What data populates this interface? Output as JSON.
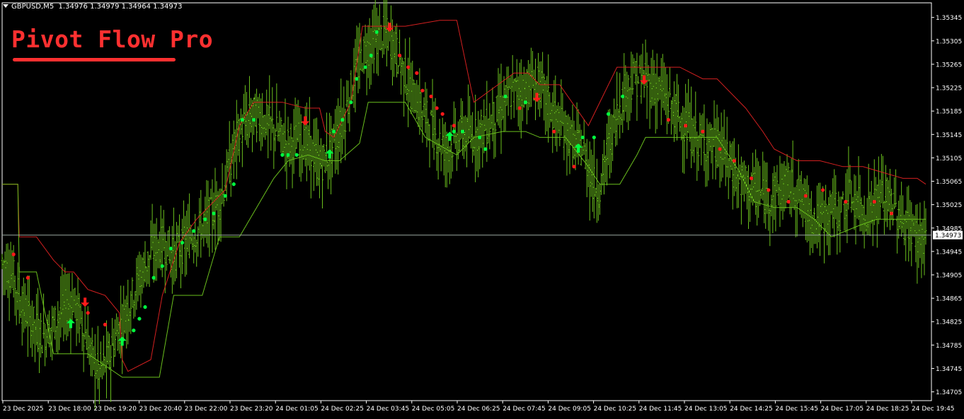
{
  "header": {
    "symbol": "GBPUSD,M5",
    "ohlc": "1.34976 1.34979 1.34964 1.34973"
  },
  "brand": {
    "title": "Pivot Flow Pro"
  },
  "colors": {
    "background": "#000000",
    "axis": "#ffffff",
    "bars": "#6abf1d",
    "bull_signal": "#00ff40",
    "bear_signal": "#ff1a1a",
    "upper_line": "#d32020",
    "lower_line": "#6abf1d",
    "bid_line": "#9aa8a0"
  },
  "chart_data": {
    "type": "bar",
    "title": "",
    "xlabel": "",
    "ylabel": "",
    "ylim": [
      1.3469,
      1.3537
    ],
    "grid": false,
    "y_ticks": [
      "1.35345",
      "1.35305",
      "1.35265",
      "1.35225",
      "1.35185",
      "1.35145",
      "1.35105",
      "1.35065",
      "1.35025",
      "1.34985",
      "1.34945",
      "1.34905",
      "1.34865",
      "1.34825",
      "1.34785",
      "1.34745",
      "1.34705"
    ],
    "current_price": "1.34973",
    "x_ticks": [
      "23 Dec 2025",
      "23 Dec 18:00",
      "23 Dec 19:20",
      "23 Dec 20:40",
      "23 Dec 22:00",
      "23 Dec 23:20",
      "24 Dec 01:05",
      "24 Dec 02:25",
      "24 Dec 03:45",
      "24 Dec 05:05",
      "24 Dec 06:25",
      "24 Dec 07:45",
      "24 Dec 09:05",
      "24 Dec 10:25",
      "24 Dec 11:45",
      "24 Dec 13:05",
      "24 Dec 14:25",
      "24 Dec 15:45",
      "24 Dec 17:05",
      "24 Dec 18:25",
      "24 Dec 19:45"
    ],
    "price_path": [
      [
        0,
        1.3493
      ],
      [
        8,
        1.349
      ],
      [
        14,
        1.3485
      ],
      [
        20,
        1.3483
      ],
      [
        28,
        1.348
      ],
      [
        36,
        1.3482
      ],
      [
        44,
        1.3485
      ],
      [
        50,
        1.3486
      ],
      [
        56,
        1.3482
      ],
      [
        62,
        1.3477
      ],
      [
        68,
        1.3474
      ],
      [
        74,
        1.3476
      ],
      [
        80,
        1.348
      ],
      [
        88,
        1.3485
      ],
      [
        96,
        1.349
      ],
      [
        104,
        1.3494
      ],
      [
        112,
        1.3496
      ],
      [
        120,
        1.3494
      ],
      [
        128,
        1.3496
      ],
      [
        136,
        1.3498
      ],
      [
        144,
        1.35
      ],
      [
        152,
        1.3503
      ],
      [
        158,
        1.3508
      ],
      [
        164,
        1.3514
      ],
      [
        170,
        1.3516
      ],
      [
        176,
        1.3518
      ],
      [
        184,
        1.3517
      ],
      [
        192,
        1.3515
      ],
      [
        200,
        1.3513
      ],
      [
        208,
        1.3514
      ],
      [
        216,
        1.3512
      ],
      [
        222,
        1.3509
      ],
      [
        228,
        1.3511
      ],
      [
        234,
        1.3514
      ],
      [
        240,
        1.3518
      ],
      [
        246,
        1.3524
      ],
      [
        252,
        1.3528
      ],
      [
        258,
        1.353
      ],
      [
        264,
        1.3531
      ],
      [
        268,
        1.3532
      ],
      [
        274,
        1.353
      ],
      [
        280,
        1.3526
      ],
      [
        286,
        1.3522
      ],
      [
        292,
        1.3519
      ],
      [
        298,
        1.3517
      ],
      [
        304,
        1.3514
      ],
      [
        310,
        1.3512
      ],
      [
        316,
        1.3513
      ],
      [
        322,
        1.3515
      ],
      [
        328,
        1.3514
      ],
      [
        334,
        1.3515
      ],
      [
        340,
        1.3516
      ],
      [
        346,
        1.3518
      ],
      [
        352,
        1.352
      ],
      [
        358,
        1.3522
      ],
      [
        364,
        1.3522
      ],
      [
        370,
        1.3523
      ],
      [
        376,
        1.3523
      ],
      [
        382,
        1.352
      ],
      [
        388,
        1.3517
      ],
      [
        394,
        1.3515
      ],
      [
        400,
        1.3513
      ],
      [
        406,
        1.3512
      ],
      [
        410,
        1.3509
      ],
      [
        414,
        1.3506
      ],
      [
        418,
        1.3505
      ],
      [
        422,
        1.351
      ],
      [
        426,
        1.3514
      ],
      [
        430,
        1.3518
      ],
      [
        436,
        1.3522
      ],
      [
        442,
        1.3524
      ],
      [
        448,
        1.3524
      ],
      [
        454,
        1.3523
      ],
      [
        460,
        1.3522
      ],
      [
        466,
        1.352
      ],
      [
        472,
        1.3518
      ],
      [
        478,
        1.3516
      ],
      [
        484,
        1.3514
      ],
      [
        490,
        1.3513
      ],
      [
        496,
        1.3513
      ],
      [
        502,
        1.3512
      ],
      [
        508,
        1.351
      ],
      [
        514,
        1.3507
      ],
      [
        520,
        1.3506
      ],
      [
        526,
        1.3505
      ],
      [
        532,
        1.3504
      ],
      [
        538,
        1.3504
      ],
      [
        544,
        1.3505
      ],
      [
        550,
        1.3506
      ],
      [
        556,
        1.3505
      ],
      [
        562,
        1.3502
      ],
      [
        568,
        1.35
      ],
      [
        574,
        1.35
      ],
      [
        580,
        1.3502
      ],
      [
        586,
        1.3501
      ],
      [
        592,
        1.3504
      ],
      [
        598,
        1.3503
      ],
      [
        604,
        1.3501
      ],
      [
        610,
        1.3503
      ],
      [
        616,
        1.3504
      ],
      [
        622,
        1.3503
      ],
      [
        628,
        1.35
      ],
      [
        634,
        1.3499
      ],
      [
        640,
        1.3497
      ],
      [
        646,
        1.3497
      ]
    ],
    "upper_line": [
      [
        0,
        1.3506
      ],
      [
        11,
        1.3506
      ],
      [
        12,
        1.3497
      ],
      [
        24,
        1.3497
      ],
      [
        36,
        1.3493
      ],
      [
        44,
        1.3491
      ],
      [
        50,
        1.3491
      ],
      [
        60,
        1.3488
      ],
      [
        72,
        1.3487
      ],
      [
        82,
        1.3484
      ],
      [
        84,
        1.3476
      ],
      [
        88,
        1.3474
      ],
      [
        104,
        1.3476
      ],
      [
        112,
        1.3487
      ],
      [
        124,
        1.3496
      ],
      [
        136,
        1.35
      ],
      [
        156,
        1.3505
      ],
      [
        166,
        1.3516
      ],
      [
        176,
        1.352
      ],
      [
        196,
        1.352
      ],
      [
        212,
        1.3519
      ],
      [
        222,
        1.3519
      ],
      [
        226,
        1.3515
      ],
      [
        232,
        1.3514
      ],
      [
        244,
        1.352
      ],
      [
        252,
        1.3533
      ],
      [
        268,
        1.3533
      ],
      [
        282,
        1.3533
      ],
      [
        306,
        1.3534
      ],
      [
        318,
        1.3534
      ],
      [
        330,
        1.352
      ],
      [
        358,
        1.3525
      ],
      [
        368,
        1.3525
      ],
      [
        376,
        1.3523
      ],
      [
        390,
        1.3523
      ],
      [
        410,
        1.3516
      ],
      [
        420,
        1.3521
      ],
      [
        430,
        1.3526
      ],
      [
        440,
        1.3526
      ],
      [
        448,
        1.3526
      ],
      [
        460,
        1.3526
      ],
      [
        474,
        1.3526
      ],
      [
        490,
        1.3524
      ],
      [
        500,
        1.3524
      ],
      [
        520,
        1.3519
      ],
      [
        532,
        1.3515
      ],
      [
        540,
        1.3512
      ],
      [
        556,
        1.351
      ],
      [
        572,
        1.351
      ],
      [
        588,
        1.3509
      ],
      [
        602,
        1.3509
      ],
      [
        616,
        1.3508
      ],
      [
        630,
        1.3507
      ],
      [
        640,
        1.3507
      ],
      [
        646,
        1.3506
      ]
    ],
    "lower_line": [
      [
        0,
        1.3506
      ],
      [
        11,
        1.3506
      ],
      [
        12,
        1.3491
      ],
      [
        24,
        1.3491
      ],
      [
        36,
        1.3477
      ],
      [
        50,
        1.3477
      ],
      [
        60,
        1.3477
      ],
      [
        84,
        1.3473
      ],
      [
        104,
        1.3473
      ],
      [
        110,
        1.3473
      ],
      [
        120,
        1.3487
      ],
      [
        140,
        1.3487
      ],
      [
        152,
        1.3497
      ],
      [
        166,
        1.3497
      ],
      [
        178,
        1.3502
      ],
      [
        190,
        1.3507
      ],
      [
        200,
        1.351
      ],
      [
        214,
        1.3511
      ],
      [
        226,
        1.351
      ],
      [
        236,
        1.351
      ],
      [
        250,
        1.3513
      ],
      [
        256,
        1.352
      ],
      [
        270,
        1.352
      ],
      [
        282,
        1.352
      ],
      [
        296,
        1.3514
      ],
      [
        318,
        1.3511
      ],
      [
        330,
        1.3514
      ],
      [
        350,
        1.3515
      ],
      [
        366,
        1.3515
      ],
      [
        376,
        1.3514
      ],
      [
        394,
        1.3514
      ],
      [
        410,
        1.3509
      ],
      [
        418,
        1.3506
      ],
      [
        432,
        1.3506
      ],
      [
        444,
        1.3511
      ],
      [
        450,
        1.3514
      ],
      [
        458,
        1.3514
      ],
      [
        468,
        1.3514
      ],
      [
        480,
        1.3514
      ],
      [
        500,
        1.3514
      ],
      [
        516,
        1.3508
      ],
      [
        526,
        1.3503
      ],
      [
        540,
        1.3502
      ],
      [
        556,
        1.3502
      ],
      [
        568,
        1.35
      ],
      [
        580,
        1.3497
      ],
      [
        600,
        1.3499
      ],
      [
        612,
        1.35
      ],
      [
        630,
        1.35
      ],
      [
        646,
        1.35
      ]
    ],
    "bull_arrows": [
      [
        48,
        1.3482
      ],
      [
        84,
        1.3479
      ],
      [
        229,
        1.3511
      ],
      [
        313,
        1.3514
      ],
      [
        403,
        1.3512
      ]
    ],
    "bear_arrows": [
      [
        58,
        1.3486
      ],
      [
        212,
        1.3517
      ],
      [
        271,
        1.3533
      ],
      [
        374,
        1.3521
      ],
      [
        449,
        1.3524
      ]
    ],
    "green_dots": [
      [
        92,
        1.3481
      ],
      [
        96,
        1.3483
      ],
      [
        100,
        1.3485
      ],
      [
        106,
        1.349
      ],
      [
        112,
        1.3492
      ],
      [
        118,
        1.3495
      ],
      [
        126,
        1.3496
      ],
      [
        134,
        1.3498
      ],
      [
        142,
        1.35
      ],
      [
        148,
        1.3501
      ],
      [
        156,
        1.3504
      ],
      [
        162,
        1.3506
      ],
      [
        168,
        1.3517
      ],
      [
        176,
        1.3517
      ],
      [
        196,
        1.3511
      ],
      [
        200,
        1.3511
      ],
      [
        206,
        1.3511
      ],
      [
        232,
        1.3515
      ],
      [
        238,
        1.3517
      ],
      [
        244,
        1.352
      ],
      [
        248,
        1.3524
      ],
      [
        254,
        1.3526
      ],
      [
        258,
        1.3528
      ],
      [
        262,
        1.3532
      ],
      [
        316,
        1.3515
      ],
      [
        322,
        1.3515
      ],
      [
        334,
        1.3514
      ],
      [
        338,
        1.3512
      ],
      [
        352,
        1.3521
      ],
      [
        366,
        1.352
      ],
      [
        406,
        1.3514
      ],
      [
        414,
        1.3514
      ],
      [
        424,
        1.3518
      ],
      [
        434,
        1.3521
      ]
    ],
    "red_dots": [
      [
        8,
        1.3494
      ],
      [
        18,
        1.349
      ],
      [
        60,
        1.3484
      ],
      [
        72,
        1.3482
      ],
      [
        278,
        1.3528
      ],
      [
        284,
        1.3526
      ],
      [
        290,
        1.3525
      ],
      [
        294,
        1.3522
      ],
      [
        300,
        1.3521
      ],
      [
        304,
        1.3519
      ],
      [
        308,
        1.3518
      ],
      [
        316,
        1.3516
      ],
      [
        362,
        1.3519
      ],
      [
        386,
        1.3515
      ],
      [
        400,
        1.3509
      ],
      [
        466,
        1.3517
      ],
      [
        478,
        1.3516
      ],
      [
        490,
        1.3515
      ],
      [
        502,
        1.3512
      ],
      [
        512,
        1.351
      ],
      [
        524,
        1.3507
      ],
      [
        536,
        1.3505
      ],
      [
        550,
        1.3503
      ],
      [
        562,
        1.3504
      ],
      [
        574,
        1.3505
      ],
      [
        590,
        1.3503
      ],
      [
        610,
        1.3503
      ],
      [
        622,
        1.3501
      ]
    ]
  }
}
